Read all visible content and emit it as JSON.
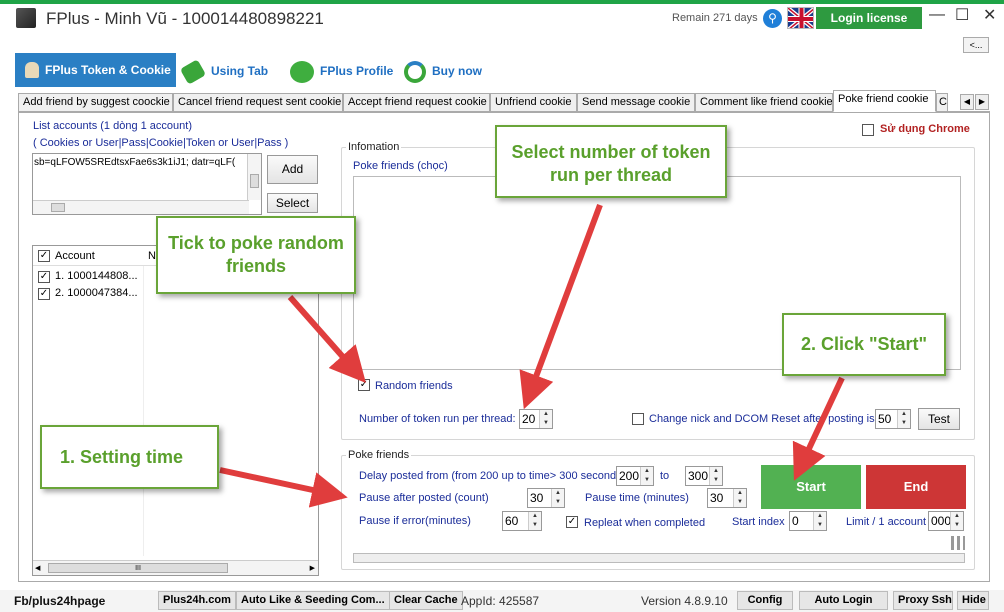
{
  "window": {
    "title": "FPlus - Minh Vũ - 100014480898221",
    "remain": "Remain 271 days",
    "login_license": "Login license",
    "back_label": "<..."
  },
  "nav_tabs": [
    "FPlus Token & Cookie",
    "Using Tab",
    "FPlus Profile",
    "Buy now"
  ],
  "sub_tabs": [
    "Add friend by suggest coockie",
    "Cancel friend request sent cookie",
    "Accept friend request cookie",
    "Unfriend cookie",
    "Send message cookie",
    "Comment like friend cookie",
    "Poke friend cookie",
    "C"
  ],
  "use_chrome": "Sử dụng Chrome",
  "accounts": {
    "title": "List accounts (1 dòng 1 account)",
    "format_hint": "( Cookies or User|Pass|Cookie|Token or User|Pass )",
    "textarea_value": "sb=qLFOW5SREdtsxFae6s3k1iJ1; datr=qLF(",
    "add_label": "Add",
    "select_label": "Select",
    "col_account": "Account",
    "col_n": "N",
    "rows": [
      "1. 1000144808...",
      "2. 1000047384..."
    ],
    "scroll_thumb": "III"
  },
  "info": {
    "group_title": "Infomation",
    "list_label": "Poke friends (chọc)",
    "random_friends": "Random friends",
    "token_per_thread_label": "Number of token run per thread:",
    "token_per_thread": "20",
    "change_nick_label": "Change nick and DCOM Reset after posting is",
    "change_nick_value": "50",
    "test_label": "Test"
  },
  "poke": {
    "group_title": "Poke friends",
    "delay_label": "Delay posted from (from 200 up to time> 300 seconds)",
    "delay_from": "200",
    "to_label": "to",
    "delay_to": "300",
    "pause_after_label": "Pause after posted (count)",
    "pause_after": "30",
    "pause_time_label": "Pause time (minutes)",
    "pause_time": "30",
    "pause_error_label": "Pause if error(minutes)",
    "pause_error": "60",
    "repeat_label": "Repleat when completed",
    "start_index_label": "Start index",
    "start_index": "0",
    "limit_label": "Limit / 1 account",
    "limit_value": "000",
    "start_label": "Start",
    "end_label": "End"
  },
  "callouts": {
    "select_token": "Select number of token run per thread",
    "tick_random": "Tick to poke random friends",
    "click_start": "2. Click \"Start\"",
    "setting_time": "1.  Setting time"
  },
  "status_bar": {
    "page": "Fb/plus24hpage",
    "site": "Plus24h.com",
    "auto_like": "Auto Like & Seeding Com...",
    "clear_cache": "Clear Cache",
    "appid": "AppId: 425587",
    "version": "Version 4.8.9.10",
    "config": "Config",
    "auto_login": "Auto Login",
    "proxy_ssh": "Proxy Ssh",
    "hide": "Hide"
  },
  "colors": {
    "accent_green": "#2e9a40",
    "start_green": "#52b152",
    "end_red": "#cd3636",
    "tab_blue": "#2a7fc4",
    "arrow_red": "#e03d3d",
    "callout_green": "#5aa02c"
  }
}
